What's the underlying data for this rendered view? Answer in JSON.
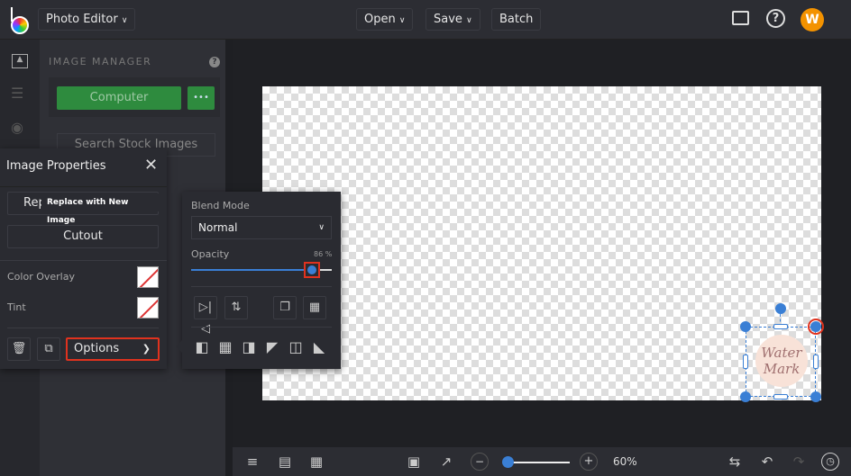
{
  "topbar": {
    "app_menu": "Photo Editor",
    "open": "Open",
    "save": "Save",
    "batch": "Batch",
    "avatar_initial": "W"
  },
  "image_manager": {
    "title": "IMAGE MANAGER",
    "computer": "Computer",
    "more": "•••",
    "search_stock": "Search Stock Images"
  },
  "image_properties": {
    "title": "Image Properties",
    "replace": "Rep",
    "tooltip": "Replace with New Image",
    "cutout": "Cutout",
    "color_overlay": "Color Overlay",
    "tint": "Tint",
    "options": "Options"
  },
  "options_panel": {
    "blend_mode_label": "Blend Mode",
    "blend_mode_value": "Normal",
    "opacity_label": "Opacity",
    "opacity_value": "86 %",
    "opacity_percent": 86
  },
  "watermark": {
    "text_line1": "Water",
    "text_line2": "Mark"
  },
  "bottombar": {
    "zoom_value": "60%",
    "zoom_percent": 60
  },
  "colors": {
    "accent": "#3a7fd5",
    "green": "#2e8b3e",
    "highlight": "#e0321e",
    "avatar": "#f39200"
  }
}
